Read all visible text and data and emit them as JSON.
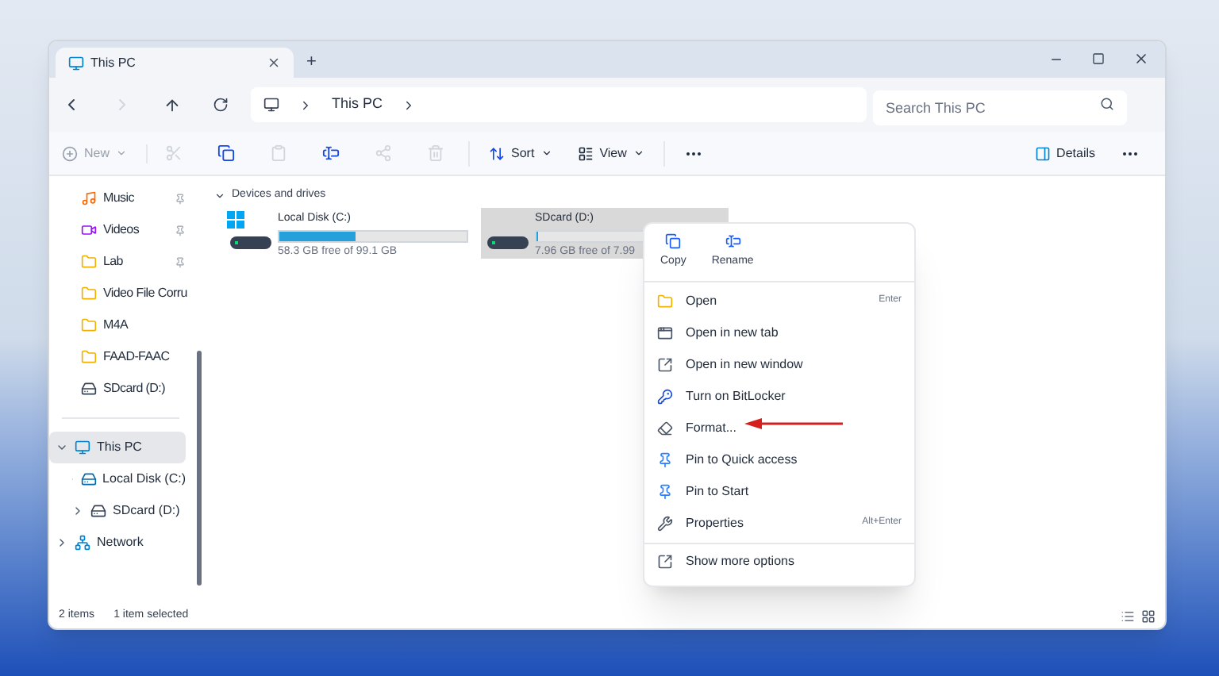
{
  "window": {
    "tab": {
      "title": "This PC",
      "selected": true
    },
    "new_tab": "+"
  },
  "address": {
    "path": [
      "This PC"
    ],
    "search": {
      "placeholder": "Search This PC"
    }
  },
  "toolbar": {
    "new": {
      "label": "New",
      "disabled": true
    },
    "actions": [
      {
        "kind": "cut",
        "disabled": true
      },
      {
        "kind": "copy",
        "disabled": false
      },
      {
        "kind": "paste",
        "disabled": true
      },
      {
        "kind": "rename",
        "disabled": false
      },
      {
        "kind": "share",
        "disabled": true
      },
      {
        "kind": "delete",
        "disabled": true
      }
    ],
    "sort": "Sort",
    "view": "View",
    "details": "Details"
  },
  "sidebar": {
    "quick": [
      {
        "label": "Music",
        "kind": "music",
        "pinned": true
      },
      {
        "label": "Videos",
        "kind": "videos",
        "pinned": true
      },
      {
        "label": "Lab",
        "kind": "folder",
        "pinned": true
      },
      {
        "label": "Video File Corru",
        "kind": "folder",
        "pinned": false
      },
      {
        "label": "M4A",
        "kind": "folder",
        "pinned": false
      },
      {
        "label": "FAAD-FAAC",
        "kind": "folder",
        "pinned": false
      },
      {
        "label": "SDcard (D:)",
        "kind": "drive",
        "pinned": false
      }
    ],
    "tree": [
      {
        "label": "This PC",
        "kind": "pc",
        "expanded": true,
        "selected": true,
        "children": [
          {
            "label": "Local Disk (C:)",
            "kind": "disk",
            "expanded": false,
            "selected": false
          },
          {
            "label": "SDcard (D:)",
            "kind": "drive",
            "expanded": false,
            "selected": false
          }
        ]
      },
      {
        "label": "Network",
        "kind": "network",
        "expanded": false,
        "selected": false
      }
    ]
  },
  "section": {
    "title": "Devices and drives",
    "expanded": true,
    "drives": [
      {
        "name": "Local Disk (C:)",
        "kind": "system",
        "free": "58.3 GB free of 99.1 GB",
        "level": 0.41,
        "selected": false
      },
      {
        "name": "SDcard (D:)",
        "kind": "removable",
        "free": "7.96 GB free of 7.99",
        "level": 0.004,
        "selected": true
      }
    ]
  },
  "context_menu": {
    "top": [
      {
        "label": "Copy",
        "kind": "copy"
      },
      {
        "label": "Rename",
        "kind": "rename"
      }
    ],
    "items": [
      {
        "label": "Open",
        "kind": "open",
        "shortcut": "Enter"
      },
      {
        "label": "Open in new tab",
        "kind": "tab"
      },
      {
        "label": "Open in new window",
        "kind": "window"
      },
      {
        "label": "Turn on BitLocker",
        "kind": "bitlocker"
      },
      {
        "label": "Format...",
        "kind": "format",
        "highlighted": true
      },
      {
        "label": "Pin to Quick access",
        "kind": "pin"
      },
      {
        "label": "Pin to Start",
        "kind": "pin"
      },
      {
        "label": "Properties",
        "kind": "properties",
        "shortcut": "Alt+Enter"
      }
    ],
    "more": {
      "label": "Show more options",
      "kind": "more"
    }
  },
  "status_bar": {
    "count": "2 items",
    "selection": "1 item selected"
  }
}
